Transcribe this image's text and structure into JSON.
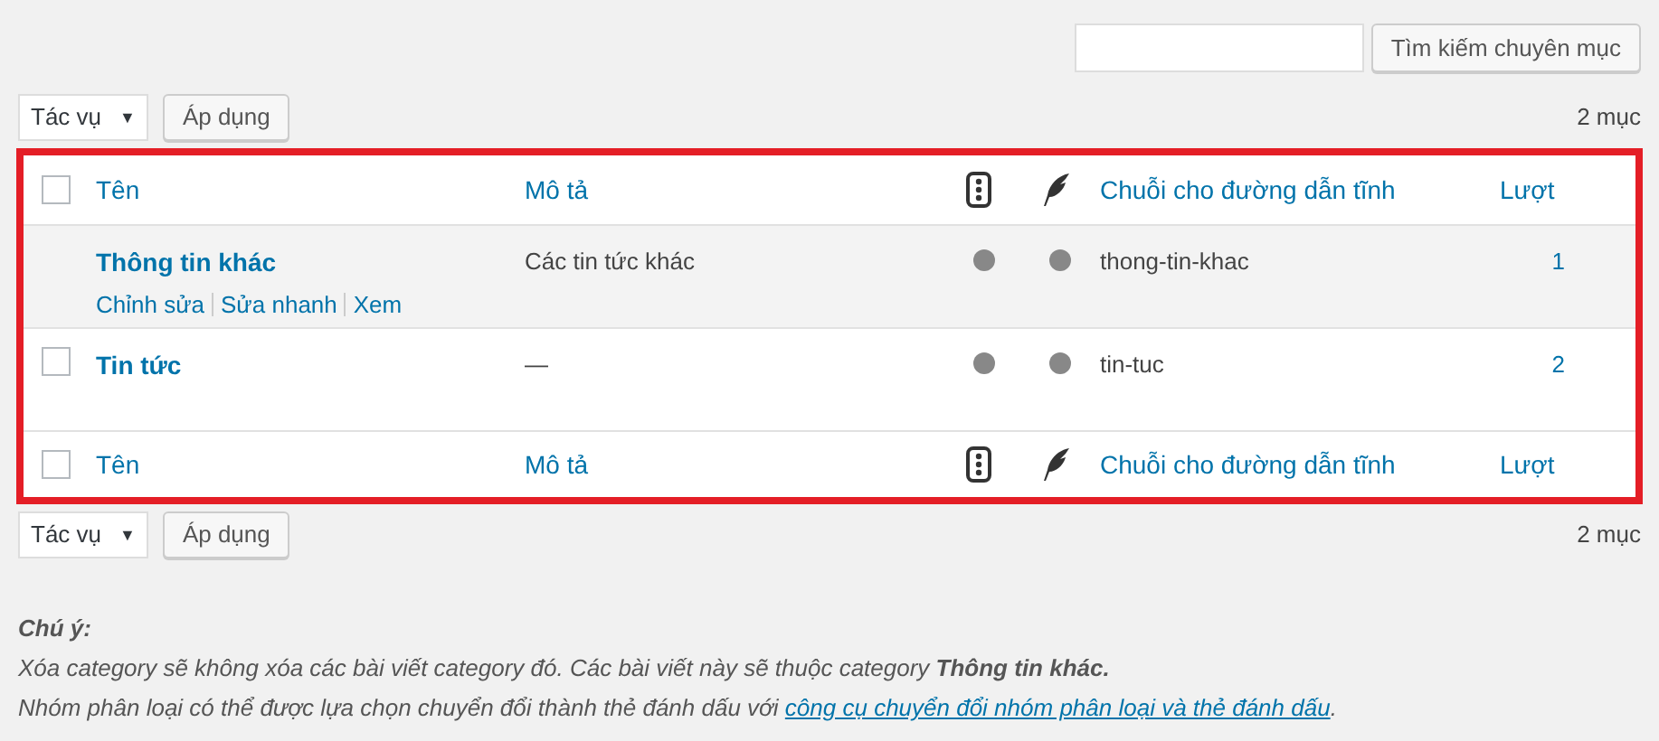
{
  "search": {
    "button": "Tìm kiếm chuyên mục"
  },
  "top_actions": {
    "bulk_select": "Tác vụ",
    "caret": "▼",
    "apply": "Áp dụng",
    "count": "2 mục"
  },
  "table": {
    "select_all_checked": false,
    "columns": [
      "Tên",
      "Mô tả",
      "Chuỗi cho đường dẫn tĩnh",
      "Lượt"
    ],
    "rows": [
      {
        "name": "Thông tin khác",
        "description": "Các tin tức khác",
        "slug": "thong-tin-khac",
        "count": "1",
        "hovered": true,
        "row_actions": [
          "Chỉnh sửa",
          "Sửa nhanh",
          "Xem"
        ]
      },
      {
        "name": "Tin tức",
        "description": "—",
        "slug": "tin-tuc",
        "count": "2",
        "checked": false,
        "hovered": false,
        "row_actions": []
      }
    ],
    "footer_select_all_checked": false,
    "footer_columns": [
      "Tên",
      "Mô tả",
      "Chuỗi cho đường dẫn tĩnh",
      "Lượt"
    ]
  },
  "bottom_actions": {
    "bulk_select": "Tác vụ",
    "caret": "▼",
    "apply": "Áp dụng",
    "count": "2 mục"
  },
  "note": {
    "title": "Chú ý:",
    "line_1": "Xóa category sẽ không xóa các bài viết category đó. Các bài viết này sẽ thuộc category **Thông tin khác.**",
    "line_2": "Nhóm phân loại có thể được lựa chọn chuyển đổi thành thẻ đánh dấu với",
    "link": "công cụ chuyển đổi nhóm phân loại và thẻ đánh dấu",
    "line_2_end": "."
  }
}
